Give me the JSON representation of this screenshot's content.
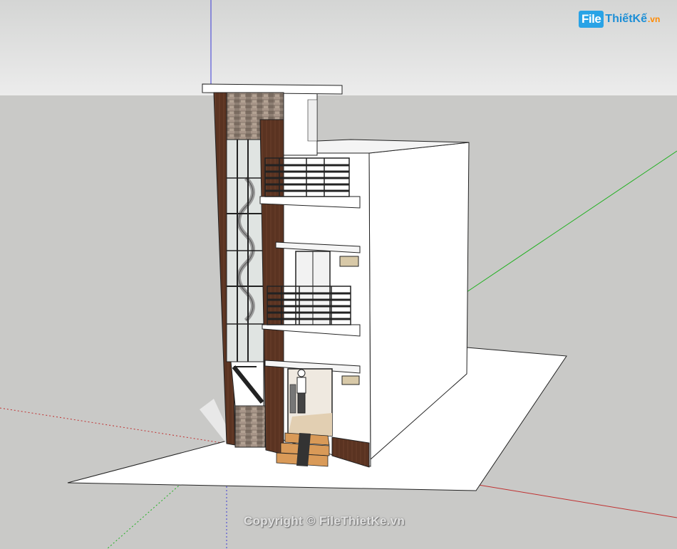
{
  "watermark": {
    "logo_box": "File",
    "logo_rest": "ThiếtKế",
    "logo_suffix": ".vn",
    "copyright": "Copyright © FileThietKe.vn"
  },
  "colors": {
    "sky": "#e5e6e5",
    "ground": "#c9c9c7",
    "wall": "#ffffff",
    "wood": "#5a3423",
    "stone": "#8d7c70",
    "glass": "#e2e6e4",
    "railing": "#222222",
    "axis_blue": "#3a3ad6",
    "axis_green": "#20b020",
    "axis_red": "#c03030"
  },
  "icons": [
    "filethietke-logo"
  ]
}
